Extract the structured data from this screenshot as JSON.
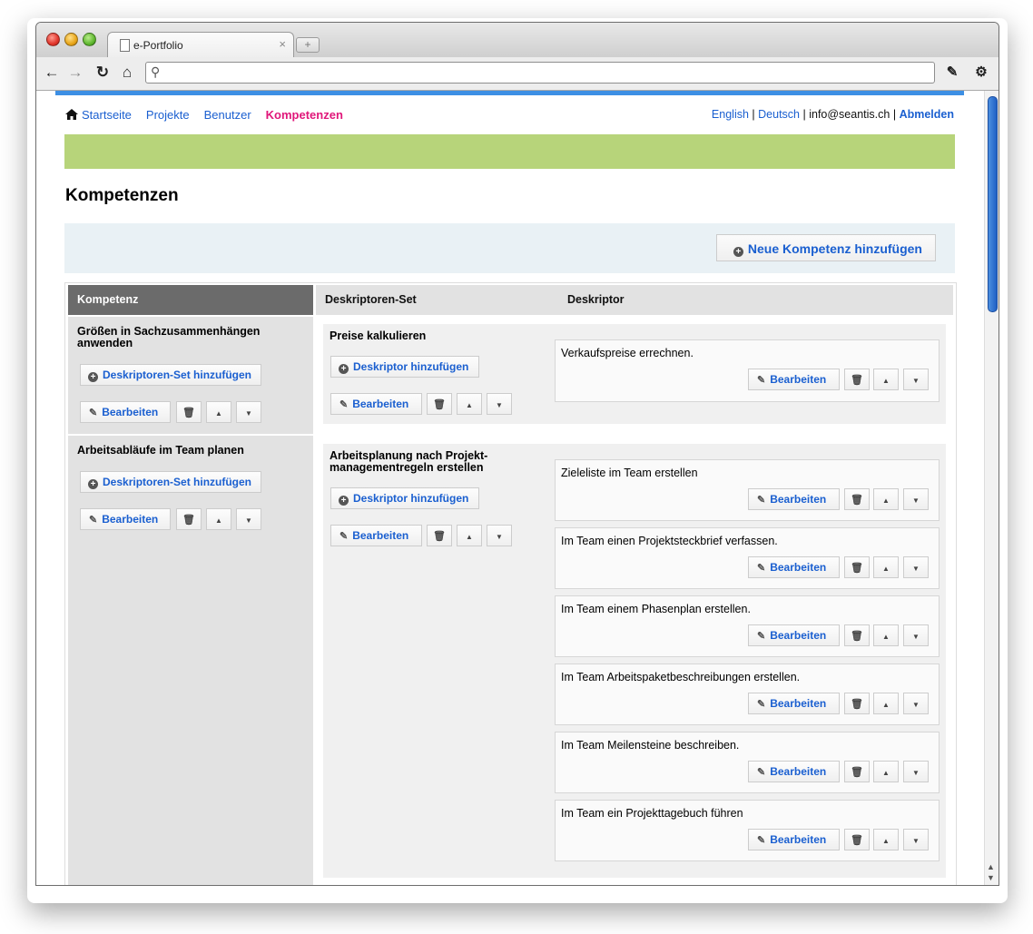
{
  "browser": {
    "tab_title": "e-Portfolio",
    "tab_close": "×",
    "new_tab": "+",
    "address": ""
  },
  "nav": {
    "items": [
      {
        "label": "Startseite"
      },
      {
        "label": "Projekte"
      },
      {
        "label": "Benutzer"
      },
      {
        "label": "Kompetenzen"
      }
    ],
    "lang_en": "English",
    "sep1": "|",
    "lang_de": "Deutsch",
    "sep2": "|",
    "email": "info@seantis.ch",
    "sep3": "|",
    "logout": "Abmelden"
  },
  "page": {
    "title": "Kompetenzen",
    "add_button": "Neue Kompetenz hinzufügen"
  },
  "table": {
    "col_kompetenz": "Kompetenz",
    "col_set": "Deskriptoren-Set",
    "col_descriptor": "Deskriptor"
  },
  "labels": {
    "add_set": "Deskriptoren-Set hinzufügen",
    "add_descriptor": "Deskriptor hinzufügen",
    "edit": "Bearbeiten"
  },
  "competencies": [
    {
      "title": "Größen in Sachzusammenhängen anwenden"
    },
    {
      "title": "Arbeitsabläufe im Team planen"
    }
  ],
  "sets": [
    {
      "title": "Preise kalkulieren",
      "descriptors": [
        "Verkaufspreise errechnen."
      ]
    },
    {
      "title": "Arbeitsplanung nach Projekt-managementregeln erstellen",
      "descriptors": [
        "Zieleliste im Team erstellen",
        "Im Team einen Projektsteckbrief verfassen.",
        "Im Team einem Phasenplan erstellen.",
        "Im Team Arbeitspaketbeschreibungen erstellen.",
        "Im Team Meilensteine beschreiben.",
        "Im Team ein Projekttagebuch führen"
      ]
    }
  ],
  "colors": {
    "accent": "#1a5fd0",
    "active_nav": "#e0177a",
    "green_bar": "#b7d47a",
    "top_border": "#3d8fe4"
  }
}
